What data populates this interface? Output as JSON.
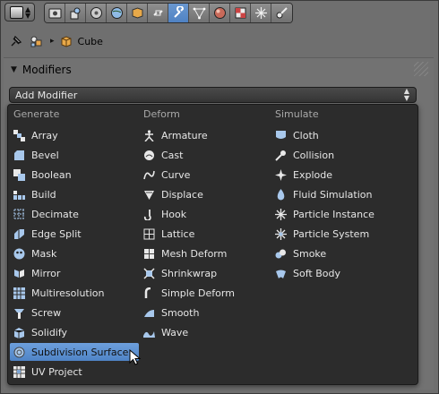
{
  "toolbar": {
    "editor_type_icon": "properties-editor-icon",
    "tabs": [
      {
        "icon": "render-icon",
        "active": false
      },
      {
        "icon": "render-layers-icon",
        "active": false
      },
      {
        "icon": "scene-icon",
        "active": false
      },
      {
        "icon": "world-icon",
        "active": false
      },
      {
        "icon": "object-icon",
        "active": false
      },
      {
        "icon": "constraints-icon",
        "active": false
      },
      {
        "icon": "modifiers-wrench-icon",
        "active": true
      },
      {
        "icon": "data-mesh-icon",
        "active": false
      },
      {
        "icon": "material-icon",
        "active": false
      },
      {
        "icon": "texture-icon",
        "active": false
      },
      {
        "icon": "particles-icon",
        "active": false
      },
      {
        "icon": "physics-icon",
        "active": false
      }
    ]
  },
  "breadcrumb": {
    "object_name": "Cube"
  },
  "panel": {
    "title": "Modifiers"
  },
  "add_modifier": {
    "label": "Add Modifier"
  },
  "menu": {
    "columns": [
      {
        "header": "Generate",
        "items": [
          {
            "label": "Array",
            "icon": "array-icon"
          },
          {
            "label": "Bevel",
            "icon": "bevel-icon"
          },
          {
            "label": "Boolean",
            "icon": "boolean-icon"
          },
          {
            "label": "Build",
            "icon": "build-icon"
          },
          {
            "label": "Decimate",
            "icon": "decimate-icon"
          },
          {
            "label": "Edge Split",
            "icon": "edge-split-icon"
          },
          {
            "label": "Mask",
            "icon": "mask-icon"
          },
          {
            "label": "Mirror",
            "icon": "mirror-icon"
          },
          {
            "label": "Multiresolution",
            "icon": "multiresolution-icon"
          },
          {
            "label": "Screw",
            "icon": "screw-icon"
          },
          {
            "label": "Solidify",
            "icon": "solidify-icon"
          },
          {
            "label": "Subdivision Surface",
            "icon": "subdivision-surface-icon",
            "highlighted": true
          },
          {
            "label": "UV Project",
            "icon": "uv-project-icon"
          }
        ]
      },
      {
        "header": "Deform",
        "items": [
          {
            "label": "Armature",
            "icon": "armature-icon"
          },
          {
            "label": "Cast",
            "icon": "cast-icon"
          },
          {
            "label": "Curve",
            "icon": "curve-icon"
          },
          {
            "label": "Displace",
            "icon": "displace-icon"
          },
          {
            "label": "Hook",
            "icon": "hook-icon"
          },
          {
            "label": "Lattice",
            "icon": "lattice-icon"
          },
          {
            "label": "Mesh Deform",
            "icon": "mesh-deform-icon"
          },
          {
            "label": "Shrinkwrap",
            "icon": "shrinkwrap-icon"
          },
          {
            "label": "Simple Deform",
            "icon": "simple-deform-icon"
          },
          {
            "label": "Smooth",
            "icon": "smooth-icon"
          },
          {
            "label": "Wave",
            "icon": "wave-icon"
          }
        ]
      },
      {
        "header": "Simulate",
        "items": [
          {
            "label": "Cloth",
            "icon": "cloth-icon"
          },
          {
            "label": "Collision",
            "icon": "collision-icon"
          },
          {
            "label": "Explode",
            "icon": "explode-icon"
          },
          {
            "label": "Fluid Simulation",
            "icon": "fluid-simulation-icon"
          },
          {
            "label": "Particle Instance",
            "icon": "particle-instance-icon"
          },
          {
            "label": "Particle System",
            "icon": "particle-system-icon"
          },
          {
            "label": "Smoke",
            "icon": "smoke-icon"
          },
          {
            "label": "Soft Body",
            "icon": "soft-body-icon"
          }
        ]
      }
    ]
  },
  "colors": {
    "highlight": "#5a8fd0",
    "menu_bg": "#2c2c2c",
    "panel_bg": "#727272",
    "active_tab": "#5b8dcb"
  }
}
